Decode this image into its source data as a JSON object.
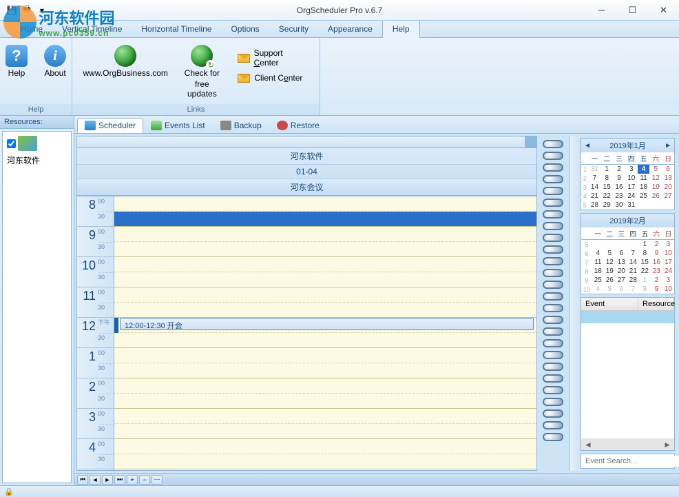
{
  "window": {
    "title": "OrgScheduler Pro v.6.7"
  },
  "watermark": {
    "cn": "河东软件园",
    "url": "www.pc0359.cn"
  },
  "ribbon": {
    "tabs": [
      "Home",
      "Vertical Timeline",
      "Horizontal Timeline",
      "Options",
      "Security",
      "Appearance",
      "Help"
    ],
    "active": "Help",
    "groups": {
      "help": {
        "label": "Help",
        "help_btn": "Help",
        "about_btn": "About"
      },
      "links": {
        "label": "Links",
        "website": "www.OrgBusiness.com",
        "updates_line1": "Check for",
        "updates_line2": "free updates",
        "support": "Support Center",
        "client": "Client Center"
      }
    }
  },
  "resources": {
    "header": "Resources:",
    "items": [
      {
        "name": "河东软件",
        "checked": true
      }
    ]
  },
  "view_tabs": [
    {
      "label": "Scheduler",
      "active": true
    },
    {
      "label": "Events List",
      "active": false
    },
    {
      "label": "Backup",
      "active": false
    },
    {
      "label": "Restore",
      "active": false
    }
  ],
  "scheduler": {
    "resource_name": "河东软件",
    "date": "01-04",
    "column": "河东会议",
    "hours": [
      {
        "h": "8",
        "suffix": "00"
      },
      {
        "h": "9",
        "suffix": "00"
      },
      {
        "h": "10",
        "suffix": "00"
      },
      {
        "h": "11",
        "suffix": "00"
      },
      {
        "h": "12",
        "suffix": "下午"
      },
      {
        "h": "1",
        "suffix": "00"
      },
      {
        "h": "2",
        "suffix": "00"
      },
      {
        "h": "3",
        "suffix": "00"
      },
      {
        "h": "4",
        "suffix": "00"
      }
    ],
    "half_label": "30",
    "event": {
      "text": "12:00-12:30 开会"
    }
  },
  "calendars": {
    "cal1": {
      "title": "2019年1月",
      "dow": [
        "一",
        "二",
        "三",
        "四",
        "五",
        "六",
        "日"
      ],
      "weeks": [
        {
          "wk": "1",
          "days": [
            {
              "d": "31",
              "o": true
            },
            {
              "d": "1"
            },
            {
              "d": "2"
            },
            {
              "d": "3"
            },
            {
              "d": "4",
              "today": true,
              "bold": true
            },
            {
              "d": "5",
              "we": true
            },
            {
              "d": "6",
              "we": true
            }
          ]
        },
        {
          "wk": "2",
          "days": [
            {
              "d": "7"
            },
            {
              "d": "8"
            },
            {
              "d": "9"
            },
            {
              "d": "10"
            },
            {
              "d": "11"
            },
            {
              "d": "12",
              "we": true
            },
            {
              "d": "13",
              "we": true
            }
          ]
        },
        {
          "wk": "3",
          "days": [
            {
              "d": "14"
            },
            {
              "d": "15"
            },
            {
              "d": "16"
            },
            {
              "d": "17"
            },
            {
              "d": "18"
            },
            {
              "d": "19",
              "we": true
            },
            {
              "d": "20",
              "we": true
            }
          ]
        },
        {
          "wk": "4",
          "days": [
            {
              "d": "21"
            },
            {
              "d": "22"
            },
            {
              "d": "23"
            },
            {
              "d": "24"
            },
            {
              "d": "25"
            },
            {
              "d": "26",
              "we": true
            },
            {
              "d": "27",
              "we": true
            }
          ]
        },
        {
          "wk": "5",
          "days": [
            {
              "d": "28"
            },
            {
              "d": "29"
            },
            {
              "d": "30"
            },
            {
              "d": "31"
            },
            {
              "d": ""
            },
            {
              "d": ""
            },
            {
              "d": ""
            }
          ]
        }
      ]
    },
    "cal2": {
      "title": "2019年2月",
      "dow": [
        "一",
        "二",
        "三",
        "四",
        "五",
        "六",
        "日"
      ],
      "weeks": [
        {
          "wk": "5",
          "days": [
            {
              "d": ""
            },
            {
              "d": ""
            },
            {
              "d": ""
            },
            {
              "d": ""
            },
            {
              "d": "1"
            },
            {
              "d": "2",
              "we": true
            },
            {
              "d": "3",
              "we": true
            }
          ]
        },
        {
          "wk": "6",
          "days": [
            {
              "d": "4"
            },
            {
              "d": "5"
            },
            {
              "d": "6"
            },
            {
              "d": "7"
            },
            {
              "d": "8"
            },
            {
              "d": "9",
              "we": true
            },
            {
              "d": "10",
              "we": true
            }
          ]
        },
        {
          "wk": "7",
          "days": [
            {
              "d": "11"
            },
            {
              "d": "12"
            },
            {
              "d": "13"
            },
            {
              "d": "14"
            },
            {
              "d": "15"
            },
            {
              "d": "16",
              "we": true
            },
            {
              "d": "17",
              "we": true
            }
          ]
        },
        {
          "wk": "8",
          "days": [
            {
              "d": "18"
            },
            {
              "d": "19"
            },
            {
              "d": "20"
            },
            {
              "d": "21"
            },
            {
              "d": "22"
            },
            {
              "d": "23",
              "we": true
            },
            {
              "d": "24",
              "we": true
            }
          ]
        },
        {
          "wk": "9",
          "days": [
            {
              "d": "25"
            },
            {
              "d": "26"
            },
            {
              "d": "27"
            },
            {
              "d": "28"
            },
            {
              "d": "1",
              "o": true
            },
            {
              "d": "2",
              "o": true,
              "we": true
            },
            {
              "d": "3",
              "o": true,
              "we": true
            }
          ]
        },
        {
          "wk": "10",
          "days": [
            {
              "d": "4",
              "o": true
            },
            {
              "d": "5",
              "o": true
            },
            {
              "d": "6",
              "o": true
            },
            {
              "d": "7",
              "o": true
            },
            {
              "d": "8",
              "o": true
            },
            {
              "d": "9",
              "o": true,
              "we": true
            },
            {
              "d": "10",
              "o": true,
              "we": true
            }
          ]
        }
      ]
    }
  },
  "event_list": {
    "cols": [
      "Event",
      "Resource"
    ]
  },
  "search": {
    "placeholder": "Event Search..."
  }
}
